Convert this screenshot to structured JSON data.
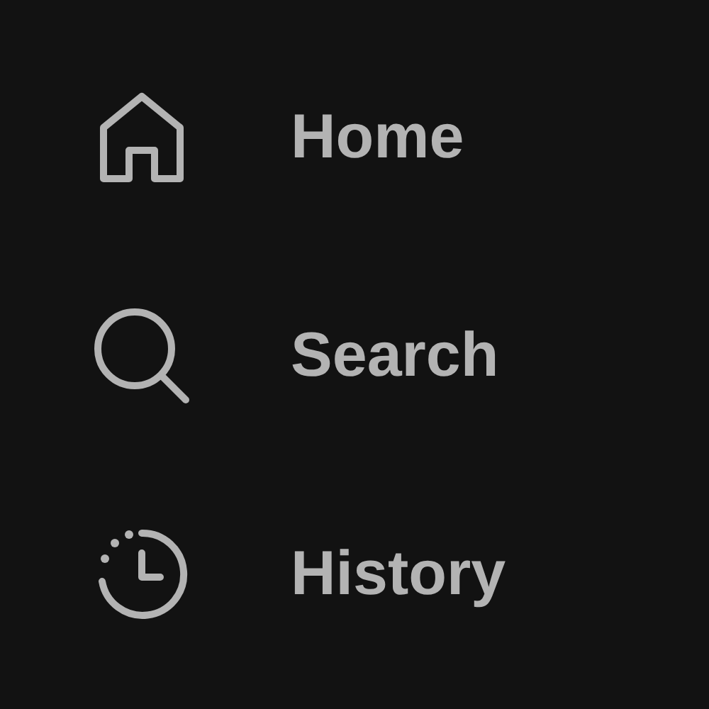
{
  "nav": [
    {
      "label": "Home"
    },
    {
      "label": "Search"
    },
    {
      "label": "History"
    }
  ]
}
